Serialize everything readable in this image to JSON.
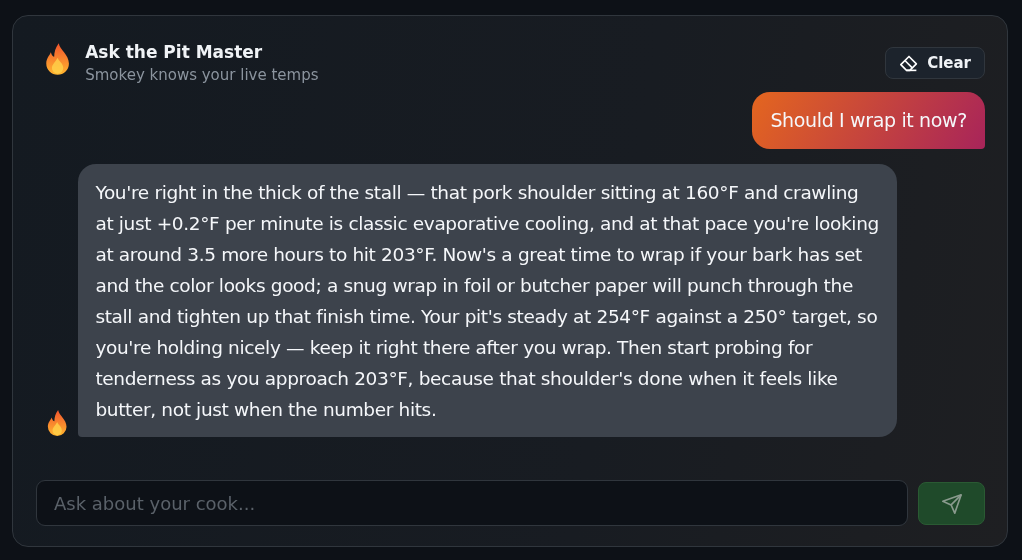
{
  "header": {
    "title": "Ask the Pit Master",
    "subtitle": "Smokey knows your live temps",
    "clear_button": "Clear"
  },
  "messages": [
    {
      "kind": "user",
      "text": "Should I wrap it now?"
    },
    {
      "kind": "assistant",
      "text": "You're right in the thick of the stall — that pork shoulder sitting at 160°F and crawling at just +0.2°F per minute is classic evaporative cooling, and at that pace you're looking at around 3.5 more hours to hit 203°F. Now's a great time to wrap if your bark has set and the color looks good; a snug wrap in foil or butcher paper will punch through the stall and tighten up that finish time. Your pit's steady at 254°F against a 250° target, so you're holding nicely — keep it right there after you wrap. Then start probing for tenderness as you approach 203°F, because that shoulder's done when it feels like butter, not just when the number hits."
    }
  ],
  "composer": {
    "placeholder": "Ask about your cook...",
    "send_disabled": true
  }
}
